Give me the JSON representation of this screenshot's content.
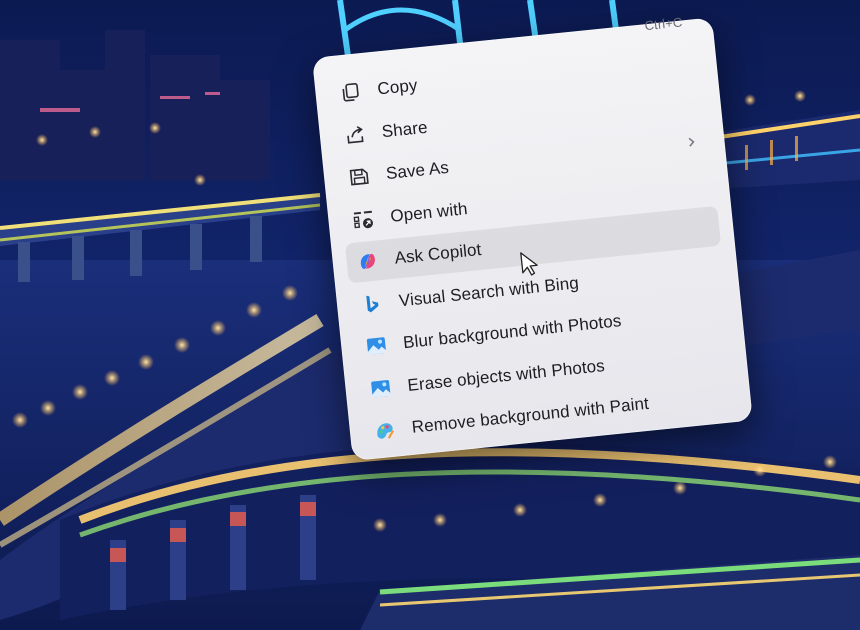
{
  "menu": {
    "copy_shortcut": "Ctrl+C",
    "items": [
      {
        "label": "Copy",
        "icon": "copy-icon"
      },
      {
        "label": "Share",
        "icon": "share-icon"
      },
      {
        "label": "Save As",
        "icon": "save-as-icon",
        "has_submenu": true
      },
      {
        "label": "Open with",
        "icon": "open-with-icon"
      },
      {
        "label": "Ask Copilot",
        "icon": "copilot-icon",
        "hovered": true
      },
      {
        "label": "Visual Search with Bing",
        "icon": "bing-icon"
      },
      {
        "label": "Blur background with Photos",
        "icon": "photos-icon"
      },
      {
        "label": "Erase objects with Photos",
        "icon": "photos-icon"
      },
      {
        "label": "Remove background with Paint",
        "icon": "paint-icon"
      }
    ]
  },
  "colors": {
    "wallpaper_sky": "#0b1540",
    "bridge_glow": "#ffcf66",
    "bridge_cyan": "#35c7ff",
    "menu_bg": "#f2f2f5"
  }
}
